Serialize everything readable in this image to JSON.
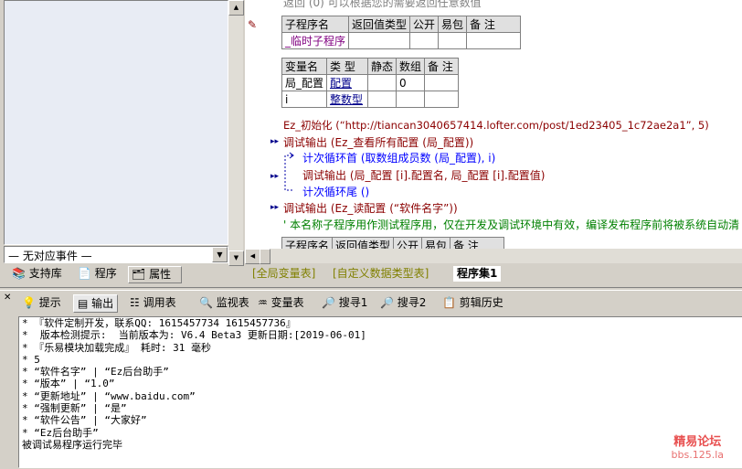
{
  "left_panel": {
    "event_select": "— 无对应事件 —",
    "tabs": [
      "支持库",
      "程序",
      "属性"
    ]
  },
  "code": {
    "top_partial": "返回 (0)    可以根据您的需要返回任意数值",
    "sub_table": {
      "headers": [
        "子程序名",
        "返回值类型",
        "公开",
        "易包",
        "备 注"
      ],
      "row": [
        "_临时子程序",
        "",
        "",
        "",
        ""
      ]
    },
    "var_table": {
      "headers": [
        "变量名",
        "类 型",
        "静态",
        "数组",
        "备 注"
      ],
      "rows": [
        [
          "局_配置",
          "配置",
          "",
          "0",
          ""
        ],
        [
          "i",
          "整数型",
          "",
          "",
          ""
        ]
      ]
    },
    "line_init": "Ez_初始化 (“http://tiancan3040657414.lofter.com/post/1ed23405_1c72ae2a1”, 5)",
    "line_debug1": "调试输出 (Ez_查看所有配置 (局_配置))",
    "line_loop_start": "计次循环首 (取数组成员数 (局_配置), i)",
    "line_debug2": "调试输出 (局_配置 [i].配置名, 局_配置 [i].配置值)",
    "line_loop_end": "计次循环尾 ()",
    "line_debug3": "调试输出 (Ez_读配置 (“软件名字”))",
    "line_comment": "' 本名称子程序用作测试程序用，仅在开发及调试环境中有效，编译发布程序前将被系统自动清",
    "bottom_partial_headers": [
      "子程序名",
      "返回值类型",
      "公开",
      "易包",
      "备 注"
    ]
  },
  "bottom_tabs": [
    "[全局变量表]",
    "[自定义数据类型表]",
    "程序集1"
  ],
  "output_tabs": [
    "提示",
    "输出",
    "调用表",
    "监视表",
    "变量表",
    "搜寻1",
    "搜寻2",
    "剪辑历史"
  ],
  "output_lines": [
    "* 『软件定制开发，联系QQ: 1615457734 1615457736』",
    "*  版本检测提示:  当前版本为: V6.4 Beta3 更新日期:[2019-06-01]",
    "* 『乐易模块加载完成』 耗时: 31 毫秒",
    "* 5",
    "* “软件名字” | “Ez后台助手”",
    "* “版本” | “1.0”",
    "* “更新地址” | “www.baidu.com”",
    "* “强制更新” | “是”",
    "* “软件公告” | “大家好”",
    "* “Ez后台助手”",
    "被调试易程序运行完毕"
  ],
  "watermark": {
    "line1": "精易论坛",
    "line2": "bbs.125.la"
  },
  "colors": {
    "code_bg": "#ffffff",
    "panel_bg": "#d4d0c8",
    "tree_bg": "#e8ecf4",
    "watermark": "#e85050"
  }
}
